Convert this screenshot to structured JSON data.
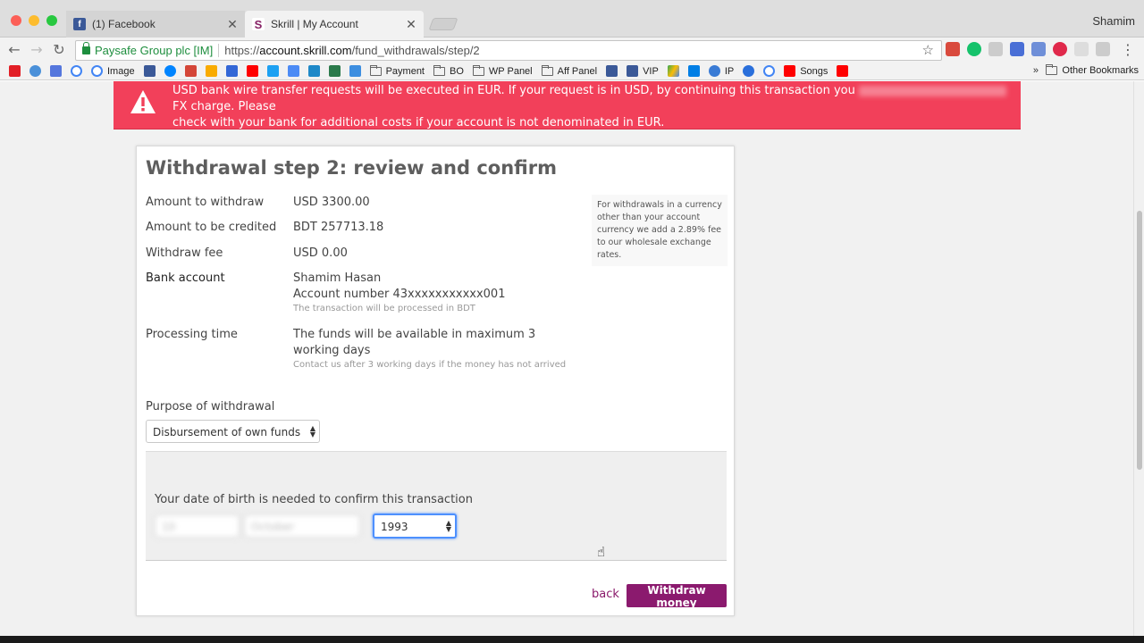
{
  "browser": {
    "tabs": [
      {
        "label": "(1) Facebook",
        "active": false,
        "icon": "facebook-icon",
        "color": "#3b5998"
      },
      {
        "label": "Skrill | My Account",
        "active": true,
        "icon": "skrill-icon",
        "color": "#862165"
      }
    ],
    "profile_name": "Shamim",
    "security_label": "Paysafe Group plc [IM]",
    "url_scheme": "https://",
    "url_host": "account.skrill.com",
    "url_path": "/fund_withdrawals/step/2"
  },
  "bookmarks": {
    "items": [
      {
        "label": "",
        "icon": "huawei-icon"
      },
      {
        "label": "",
        "icon": "broadcast-icon"
      },
      {
        "label": "",
        "icon": "rss-icon"
      },
      {
        "label": "",
        "icon": "google-icon"
      },
      {
        "label": "Image",
        "icon": "google-icon"
      },
      {
        "label": "",
        "icon": "facebook-icon"
      },
      {
        "label": "",
        "icon": "messenger-icon"
      },
      {
        "label": "",
        "icon": "gmail-icon"
      },
      {
        "label": "",
        "icon": "analytics-icon"
      },
      {
        "label": "",
        "icon": "adwords-icon"
      },
      {
        "label": "",
        "icon": "youtube-icon"
      },
      {
        "label": "",
        "icon": "twitter-icon"
      },
      {
        "label": "",
        "icon": "translate-icon"
      },
      {
        "label": "",
        "icon": "sheet-icon"
      },
      {
        "label": "",
        "icon": "skrill-icon"
      },
      {
        "label": "",
        "icon": "mail-icon"
      },
      {
        "label": "Payment",
        "icon": "folder-icon"
      },
      {
        "label": "BO",
        "icon": "folder-icon"
      },
      {
        "label": "WP Panel",
        "icon": "folder-icon"
      },
      {
        "label": "Aff Panel",
        "icon": "folder-icon"
      },
      {
        "label": "",
        "icon": "facebook-icon"
      },
      {
        "label": "VIP",
        "icon": "facebook-icon"
      },
      {
        "label": "",
        "icon": "drive-icon"
      },
      {
        "label": "",
        "icon": "dropbox-icon"
      },
      {
        "label": "IP",
        "icon": "globe-icon"
      },
      {
        "label": "",
        "icon": "refresh-site-icon"
      },
      {
        "label": "",
        "icon": "google-icon"
      },
      {
        "label": "Songs",
        "icon": "youtube-icon"
      },
      {
        "label": "",
        "icon": "youtube-icon"
      }
    ],
    "overflow": "»",
    "other": "Other Bookmarks"
  },
  "alert": {
    "line1": "USD bank wire transfer requests will be executed in EUR. If your request is in USD, by continuing this transaction you",
    "line1_end": "FX charge. Please",
    "line2": "check with your bank for additional costs if your account is not denominated in EUR."
  },
  "form": {
    "title": "Withdrawal step 2: review and confirm",
    "amount_label": "Amount to withdraw",
    "amount_value": "USD 3300.00",
    "credited_label": "Amount to be credited",
    "credited_value": "BDT 257713.18",
    "fee_label": "Withdraw fee",
    "fee_value": "USD 0.00",
    "bank_label": "Bank account",
    "bank_name": "Shamim Hasan",
    "bank_number": "Account number 43xxxxxxxxxxx001",
    "bank_note": "The transaction will be processed in BDT",
    "processing_label": "Processing time",
    "processing_value": "The funds will be available in maximum 3 working days",
    "processing_note": "Contact us after 3 working days if the money has not arrived",
    "side_note": "For withdrawals in a currency other than your account currency we add a 2.89% fee to our wholesale exchange rates.",
    "purpose_label": "Purpose of withdrawal",
    "purpose_value": "Disbursement of own funds",
    "dob_label": "Your date of birth is needed to confirm this transaction",
    "dob_day": "10",
    "dob_month": "October",
    "dob_year": "1993",
    "back_label": "back",
    "submit_label": "Withdraw money"
  },
  "colors": {
    "alert": "#f2405a",
    "brand": "#8b1a6e",
    "secure": "#1e8e3e"
  }
}
